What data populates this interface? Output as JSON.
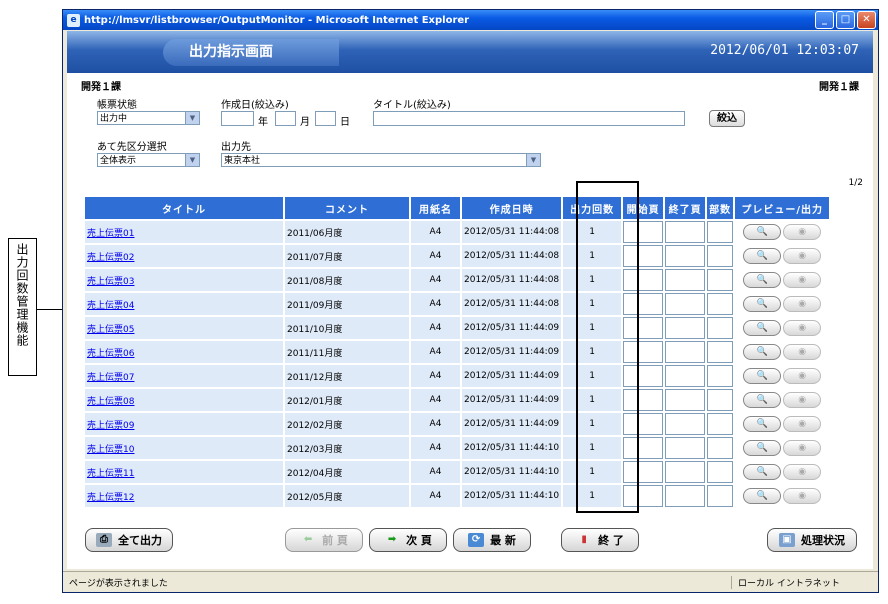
{
  "annotation": {
    "text": "出力回数管理機能"
  },
  "window": {
    "title": "http://lmsvr/listbrowser/OutputMonitor - Microsoft Internet Explorer"
  },
  "header": {
    "title": "出力指示画面",
    "datetime": "2012/06/01  12:03:07"
  },
  "dept_left": "開発１課",
  "dept_right": "開発１課",
  "filters": {
    "status_label": "帳票状態",
    "status_value": "出力中",
    "date_label": "作成日(絞込み)",
    "year_label": "年",
    "month_label": "月",
    "day_label": "日",
    "title_label": "タイトル(絞込み)",
    "filter_button": "絞込",
    "dest_class_label": "あて先区分選択",
    "dest_class_value": "全体表示",
    "dest_label": "出力先",
    "dest_value": "東京本社"
  },
  "page_indicator": "1/2",
  "table": {
    "headers": [
      "タイトル",
      "コメント",
      "用紙名",
      "作成日時",
      "出力回数",
      "開始頁",
      "終了頁",
      "部数",
      "プレビュー/出力"
    ],
    "rows": [
      {
        "title": "売上伝票01",
        "comment": "2011/06月度",
        "paper": "A4",
        "created": "2012/05/31 11:44:08",
        "count": "1"
      },
      {
        "title": "売上伝票02",
        "comment": "2011/07月度",
        "paper": "A4",
        "created": "2012/05/31 11:44:08",
        "count": "1"
      },
      {
        "title": "売上伝票03",
        "comment": "2011/08月度",
        "paper": "A4",
        "created": "2012/05/31 11:44:08",
        "count": "1"
      },
      {
        "title": "売上伝票04",
        "comment": "2011/09月度",
        "paper": "A4",
        "created": "2012/05/31 11:44:08",
        "count": "1"
      },
      {
        "title": "売上伝票05",
        "comment": "2011/10月度",
        "paper": "A4",
        "created": "2012/05/31 11:44:09",
        "count": "1"
      },
      {
        "title": "売上伝票06",
        "comment": "2011/11月度",
        "paper": "A4",
        "created": "2012/05/31 11:44:09",
        "count": "1"
      },
      {
        "title": "売上伝票07",
        "comment": "2011/12月度",
        "paper": "A4",
        "created": "2012/05/31 11:44:09",
        "count": "1"
      },
      {
        "title": "売上伝票08",
        "comment": "2012/01月度",
        "paper": "A4",
        "created": "2012/05/31 11:44:09",
        "count": "1"
      },
      {
        "title": "売上伝票09",
        "comment": "2012/02月度",
        "paper": "A4",
        "created": "2012/05/31 11:44:09",
        "count": "1"
      },
      {
        "title": "売上伝票10",
        "comment": "2012/03月度",
        "paper": "A4",
        "created": "2012/05/31 11:44:10",
        "count": "1"
      },
      {
        "title": "売上伝票11",
        "comment": "2012/04月度",
        "paper": "A4",
        "created": "2012/05/31 11:44:10",
        "count": "1"
      },
      {
        "title": "売上伝票12",
        "comment": "2012/05月度",
        "paper": "A4",
        "created": "2012/05/31 11:44:10",
        "count": "1"
      }
    ]
  },
  "buttons": {
    "output_all": "全て出力",
    "prev": "前 頁",
    "next": "次 頁",
    "refresh": "最 新",
    "exit": "終 了",
    "status": "処理状況"
  },
  "statusbar": {
    "left": "ページが表示されました",
    "right": "ローカル イントラネット"
  },
  "colors": {
    "header_blue": "#2f63b7",
    "table_header": "#2f6fd5",
    "cell_bg": "#dfeaf8",
    "link": "#0000ee"
  }
}
